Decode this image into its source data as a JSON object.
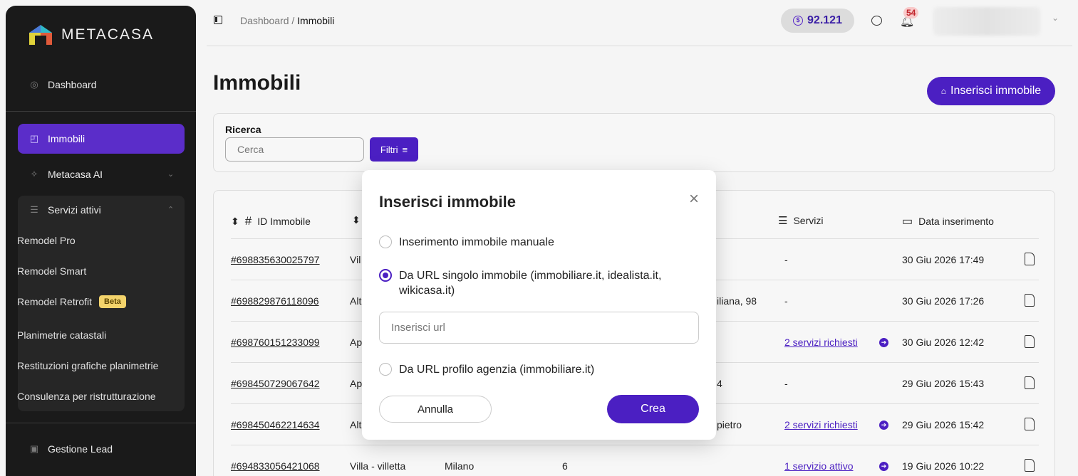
{
  "sidebar": {
    "logo_text": "METACASA",
    "items": {
      "dashboard": "Dashboard",
      "immobili": "Immobili",
      "metacasa_ai": "Metacasa AI",
      "servizi_attivi": "Servizi attivi",
      "gestione_lead": "Gestione Lead"
    },
    "sub_items": [
      "Remodel Pro",
      "Remodel Smart",
      "Remodel Retrofit",
      "Planimetrie catastali",
      "Restituzioni grafiche planimetrie",
      "Consulenza per ristrutturazione"
    ],
    "beta_label": "Beta"
  },
  "topbar": {
    "breadcrumb_root": "Dashboard",
    "breadcrumb_sep": "/",
    "breadcrumb_current": "Immobili",
    "credits": "92.121",
    "coin_symbol": "$",
    "notifications": "54"
  },
  "main": {
    "title": "Immobili",
    "add_button": "Inserisci immobile",
    "search_label": "Ricerca",
    "search_placeholder": "Cerca",
    "filter_button": "Filtri",
    "columns": {
      "id": "ID Immobile",
      "servizi": "Servizi",
      "data": "Data inserimento"
    },
    "rows": [
      {
        "id": "#698835630025797",
        "type": "Vil",
        "city": "",
        "rooms": "",
        "address": "",
        "services": "-",
        "date": "30 Giu 2026 17:49"
      },
      {
        "id": "#698829876118096",
        "type": "Alt",
        "city": "",
        "rooms": "",
        "address": "iliana, 98",
        "services": "-",
        "date": "30 Giu 2026 17:26"
      },
      {
        "id": "#698760151233099",
        "type": "Ap",
        "city": "",
        "rooms": "",
        "address": "",
        "services": "2 servizi richiesti",
        "date": "30 Giu 2026 12:42"
      },
      {
        "id": "#698450729067642",
        "type": "Ap",
        "city": "",
        "rooms": "",
        "address": "4",
        "services": "-",
        "date": "29 Giu 2026 15:43"
      },
      {
        "id": "#698450462214634",
        "type": "Alt",
        "city": "",
        "rooms": "",
        "address": "pietro",
        "services": "2 servizi richiesti",
        "date": "29 Giu 2026 15:42"
      },
      {
        "id": "#694833056421068",
        "type": "Villa - villetta",
        "city": "Milano",
        "rooms": "6",
        "address": "",
        "services": "1 servizio attivo",
        "date": "19 Giu 2026 10:22"
      }
    ]
  },
  "modal": {
    "title": "Inserisci immobile",
    "options": [
      "Inserimento immobile manuale",
      "Da URL singolo immobile (immobiliare.it, idealista.it, wikicasa.it)",
      "Da URL profilo agenzia (immobiliare.it)"
    ],
    "selected_option": 1,
    "url_placeholder": "Inserisci url",
    "cancel_button": "Annulla",
    "create_button": "Crea"
  },
  "colors": {
    "accent": "#4b1fc2",
    "sidebar_bg": "#1a1a1a",
    "badge_bg": "#f8c9c9",
    "beta_bg": "#f3d36b"
  }
}
